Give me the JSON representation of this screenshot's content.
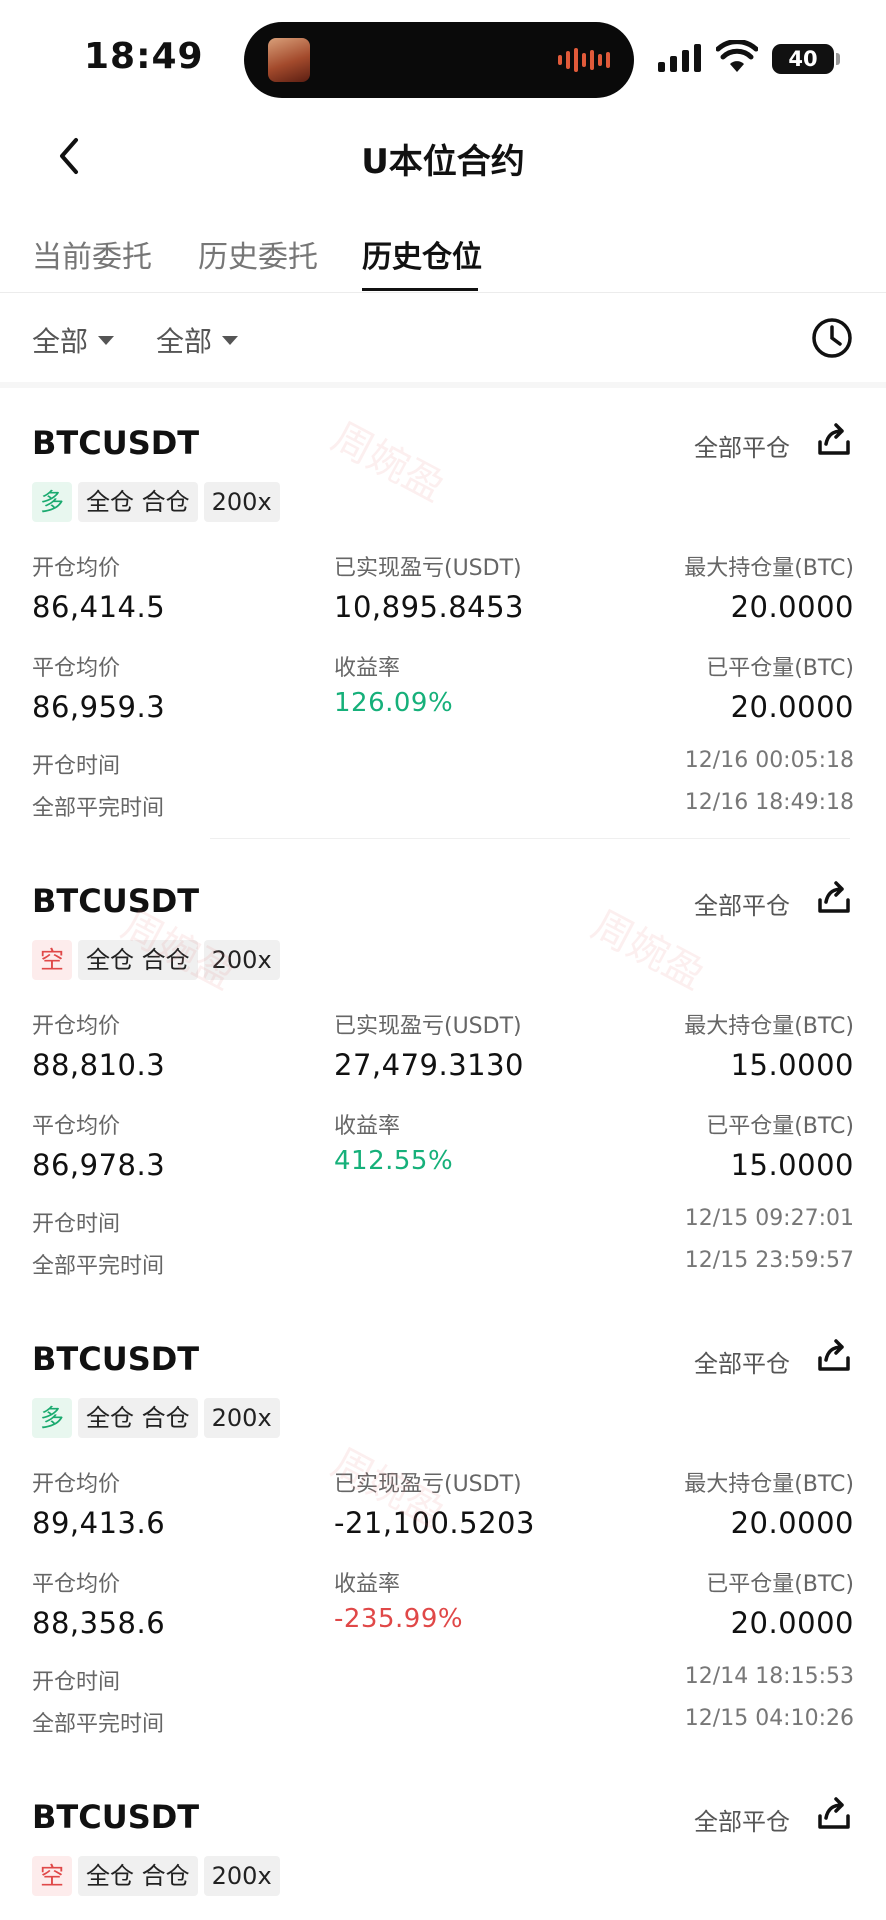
{
  "status_bar": {
    "time": "18:49",
    "battery": "40"
  },
  "header": {
    "title": "U本位合约"
  },
  "tabs": [
    {
      "label": "当前委托",
      "active": false
    },
    {
      "label": "历史委托",
      "active": false
    },
    {
      "label": "历史仓位",
      "active": true
    }
  ],
  "filters": {
    "filter1": "全部",
    "filter2": "全部"
  },
  "labels": {
    "close_all": "全部平仓",
    "open_avg": "开仓均价",
    "realized_pnl": "已实现盈亏(USDT)",
    "max_position": "最大持仓量(BTC)",
    "close_avg": "平仓均价",
    "return_rate": "收益率",
    "closed_qty": "已平仓量(BTC)",
    "open_time": "开仓时间",
    "full_close_time": "全部平完时间"
  },
  "watermark": "周婉盈",
  "positions": [
    {
      "symbol": "BTCUSDT",
      "side": "多",
      "margin_mode": "全仓 合仓",
      "leverage": "200x",
      "open_avg": "86,414.5",
      "realized_pnl": "10,895.8453",
      "max_position": "20.0000",
      "close_avg": "86,959.3",
      "return_rate": "126.09%",
      "closed_qty": "20.0000",
      "open_time": "12/16 00:05:18",
      "full_close_time": "12/16 18:49:18",
      "return_color": "#16b07a"
    },
    {
      "symbol": "BTCUSDT",
      "side": "空",
      "margin_mode": "全仓 合仓",
      "leverage": "200x",
      "open_avg": "88,810.3",
      "realized_pnl": "27,479.3130",
      "max_position": "15.0000",
      "close_avg": "86,978.3",
      "return_rate": "412.55%",
      "closed_qty": "15.0000",
      "open_time": "12/15 09:27:01",
      "full_close_time": "12/15 23:59:57",
      "return_color": "#16b07a"
    },
    {
      "symbol": "BTCUSDT",
      "side": "多",
      "margin_mode": "全仓 合仓",
      "leverage": "200x",
      "open_avg": "89,413.6",
      "realized_pnl": "-21,100.5203",
      "max_position": "20.0000",
      "close_avg": "88,358.6",
      "return_rate": "-235.99%",
      "closed_qty": "20.0000",
      "open_time": "12/14 18:15:53",
      "full_close_time": "12/15 04:10:26",
      "return_color": "#e04848"
    },
    {
      "symbol": "BTCUSDT",
      "side": "空",
      "margin_mode": "全仓 合仓",
      "leverage": "200x"
    }
  ]
}
